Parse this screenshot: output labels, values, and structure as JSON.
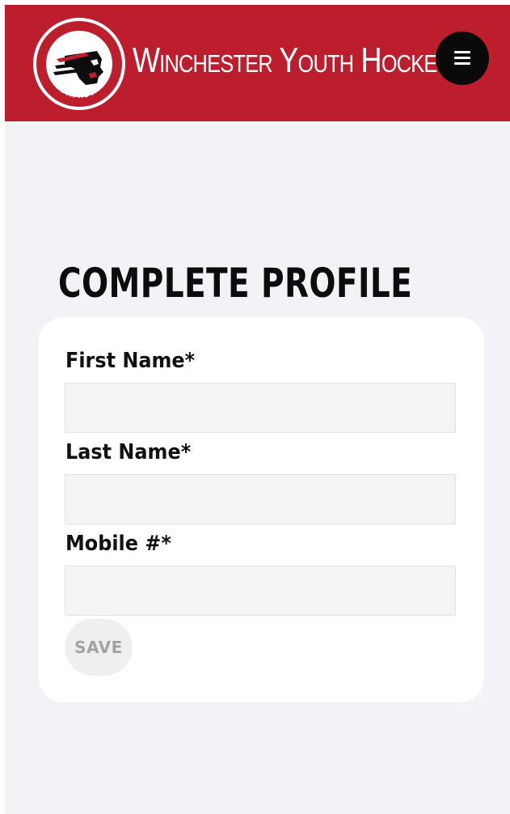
{
  "header": {
    "brand_name": "Winchester Youth Hockey",
    "logo": {
      "top_text": "WINCHESTER",
      "bottom_text": "YOUTH HOCKEY",
      "icon": "warrior-head-logo-icon"
    },
    "menu_icon": "hamburger-menu-icon"
  },
  "main": {
    "title": "COMPLETE PROFILE",
    "form": {
      "fields": [
        {
          "label": "First Name*",
          "value": "",
          "placeholder": ""
        },
        {
          "label": "Last Name*",
          "value": "",
          "placeholder": ""
        },
        {
          "label": "Mobile #*",
          "value": "",
          "placeholder": ""
        }
      ],
      "save_label": "SAVE"
    }
  },
  "colors": {
    "brand_red": "#bd1e2d",
    "page_background": "#f1f3f6",
    "card_background": "#ffffff",
    "menu_button": "#0a0a0a",
    "field_background": "#f5f3f4",
    "save_button_background": "#efefef",
    "save_button_text": "#a2a2a2"
  }
}
